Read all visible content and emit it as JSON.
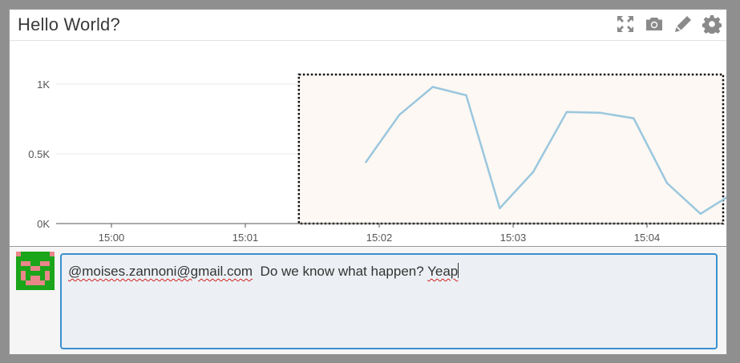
{
  "widget": {
    "title": "Hello World?"
  },
  "toolbar": {
    "icons": [
      "fullscreen-icon",
      "camera-icon",
      "pencil-icon",
      "gear-icon"
    ]
  },
  "colors": {
    "line": "#9ac7de",
    "selection_fill": "#fdf8f3",
    "focus_border": "#3a8fcf",
    "avatar_green": "#1aa51a",
    "avatar_pink": "#e8868a"
  },
  "chart_data": {
    "type": "line",
    "title": "",
    "xlabel": "",
    "ylabel": "",
    "ylim": [
      0,
      1000
    ],
    "y_ticks": [
      {
        "value": 0,
        "label": "0K"
      },
      {
        "value": 500,
        "label": "0.5K"
      },
      {
        "value": 1000,
        "label": "1K"
      }
    ],
    "x_ticks": [
      "15:00",
      "15:01",
      "15:02",
      "15:03",
      "15:04"
    ],
    "grid": true,
    "series": [
      {
        "values": [
          {
            "t": "15:01:54",
            "y": 440
          },
          {
            "t": "15:02:09",
            "y": 780
          },
          {
            "t": "15:02:24",
            "y": 980
          },
          {
            "t": "15:02:39",
            "y": 920
          },
          {
            "t": "15:02:54",
            "y": 110
          },
          {
            "t": "15:03:09",
            "y": 370
          },
          {
            "t": "15:03:24",
            "y": 800
          },
          {
            "t": "15:03:39",
            "y": 795
          },
          {
            "t": "15:03:54",
            "y": 755
          },
          {
            "t": "15:04:09",
            "y": 290
          },
          {
            "t": "15:04:24",
            "y": 70
          },
          {
            "t": "15:04:39",
            "y": 220
          }
        ]
      }
    ],
    "selection": {
      "x_start": "15:01:24",
      "x_end": "15:04:39",
      "y_top": 1000
    }
  },
  "comment": {
    "mention": "@moises.zannoni@gmail.com",
    "text": "  Do we know what happen? ",
    "last_word": "Yeap"
  }
}
